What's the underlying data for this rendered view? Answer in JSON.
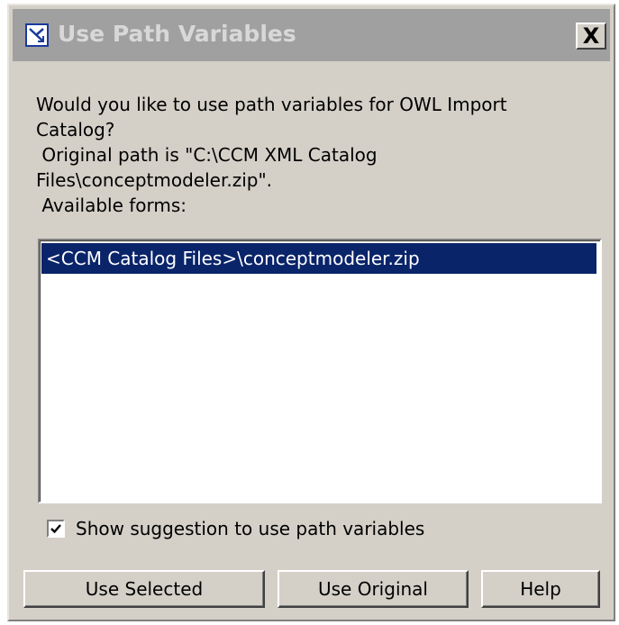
{
  "dialog": {
    "title": "Use Path Variables",
    "close_label": "X",
    "message_lines": [
      "Would you like to use path variables for OWL Import",
      "Catalog?",
      " Original path is \"C:\\CCM XML Catalog",
      "Files\\conceptmodeler.zip\".",
      " Available forms:"
    ],
    "forms": [
      "<CCM Catalog Files>\\conceptmodeler.zip"
    ],
    "show_suggestion": {
      "label": "Show suggestion to use path variables",
      "checked": true
    },
    "buttons": {
      "use_selected": "Use Selected",
      "use_original": "Use Original",
      "help": "Help"
    }
  },
  "colors": {
    "dialog_bg": "#d4d0c8",
    "titlebar_inactive": "#a0a0a0",
    "selection": "#0a246a"
  }
}
